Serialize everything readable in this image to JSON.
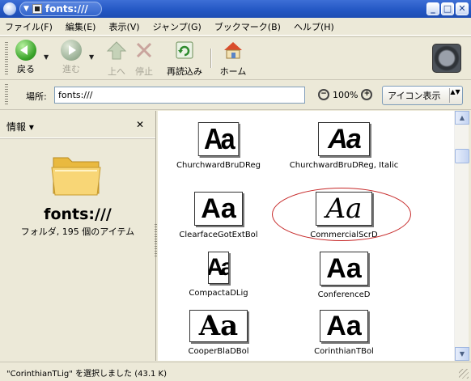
{
  "window": {
    "title": "fonts:///",
    "minimize_label": "_",
    "maximize_label": "□",
    "close_label": "✕",
    "title_dropdown_glyph": "▼"
  },
  "menu": [
    "ファイル(F)",
    "編集(E)",
    "表示(V)",
    "ジャンプ(G)",
    "ブックマーク(B)",
    "ヘルプ(H)"
  ],
  "toolbar": {
    "back": "戻る",
    "forward": "進む",
    "up": "上へ",
    "stop": "停止",
    "reload": "再読込み",
    "home": "ホーム",
    "dropdown_glyph": "▼"
  },
  "location": {
    "label": "場所:",
    "value": "fonts:///",
    "zoom_level": "100%",
    "zoom_out_glyph": "−",
    "zoom_in_glyph": "+",
    "view_mode": "アイコン表示",
    "view_arrows": "▲▼"
  },
  "sidebar": {
    "title": "情報 ▾",
    "close_glyph": "✕",
    "folder_name": "fonts:///",
    "info": "フォルダ, 195 個のアイテム"
  },
  "fonts": [
    {
      "name": "ChurchwardBruDReg",
      "sample": "Aa",
      "highlighted": false
    },
    {
      "name": "ChurchwardBruDReg, Italic",
      "sample": "Aa",
      "highlighted": false
    },
    {
      "name": "ClearfaceGotExtBol",
      "sample": "Aa",
      "highlighted": false
    },
    {
      "name": "CommercialScrD",
      "sample": "Aa",
      "highlighted": true
    },
    {
      "name": "CompactaDLig",
      "sample": "Aa",
      "highlighted": false
    },
    {
      "name": "ConferenceD",
      "sample": "Aa",
      "highlighted": false
    },
    {
      "name": "CooperBlaDBol",
      "sample": "Aa",
      "highlighted": false
    },
    {
      "name": "CorinthianTBol",
      "sample": "Aa",
      "highlighted": false
    }
  ],
  "scrollbar": {
    "up_glyph": "▲",
    "down_glyph": "▼",
    "position": 0.08
  },
  "status": "\"CorinthianTLig\" を選択しました (43.1 K)",
  "colors": {
    "titlebar": "#2458c4",
    "highlight_ellipse": "#c62828",
    "window_bg": "#ece9d8"
  }
}
